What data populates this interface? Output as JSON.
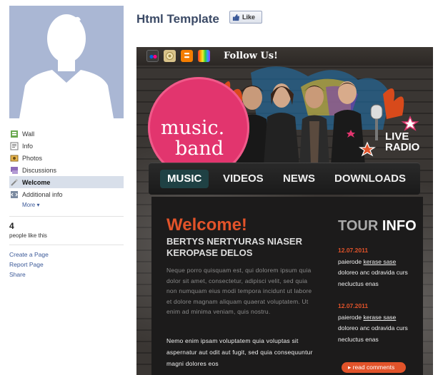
{
  "page": {
    "title": "Html Template",
    "like_label": "Like"
  },
  "sidebar": {
    "items": [
      {
        "label": "Wall",
        "icon": "wall-icon",
        "active": false
      },
      {
        "label": "Info",
        "icon": "info-icon",
        "active": false
      },
      {
        "label": "Photos",
        "icon": "photos-icon",
        "active": false
      },
      {
        "label": "Discussions",
        "icon": "discussions-icon",
        "active": false
      },
      {
        "label": "Welcome",
        "icon": "welcome-icon",
        "active": true
      },
      {
        "label": "Additional info",
        "icon": "additional-info-icon",
        "active": false
      }
    ],
    "more_label": "More ▾",
    "likes_count": "4",
    "likes_text": "people like this",
    "links": [
      "Create a Page",
      "Report Page",
      "Share"
    ]
  },
  "template": {
    "follow_text": "Follow Us!",
    "social_icons": [
      "flickr-icon",
      "delicious-icon",
      "blogger-icon",
      "rainbow-icon"
    ],
    "logo_line1": "music.",
    "logo_line2": "band",
    "live_line1": "LIVE",
    "live_line2": "RADIO",
    "menu": [
      "MUSIC",
      "VIDEOS",
      "NEWS",
      "DOWNLOADS"
    ],
    "welcome_heading": "Welcome!",
    "subheading": "BERTYS NERTYURAS NIASER KEROPASE DELOS",
    "body_dim": "Neque porro quisquam est, qui dolorem ipsum quia dolor sit amet, consectetur, adipisci velit, sed quia non numquam eius modi tempora incidunt ut labore et dolore magnam aliquam quaerat voluptatem. Ut enim ad minima veniam, quis nostru.",
    "body_bright": "Nemo enim ipsam voluptatem quia voluptas sit aspernatur aut odit aut fugit, sed quia consequuntur magni dolores eos",
    "tour_title_1": "TOUR",
    "tour_title_2": "INFO",
    "tour_entries": [
      {
        "date": "12.07.2011",
        "pre": "paierode ",
        "link": "kerase sase",
        "rest": "doloreo anc odravida curs necluctus enas"
      },
      {
        "date": "12.07.2011",
        "pre": "paierode ",
        "link": "kerase sase",
        "rest": "doloreo anc odravida curs necluctus enas"
      }
    ],
    "read_comments": "▸ read comments",
    "colors": {
      "accent": "#e2532a",
      "pink": "#e2356e",
      "menu_active": "#1f4144",
      "fb_blue": "#3b5998"
    }
  }
}
